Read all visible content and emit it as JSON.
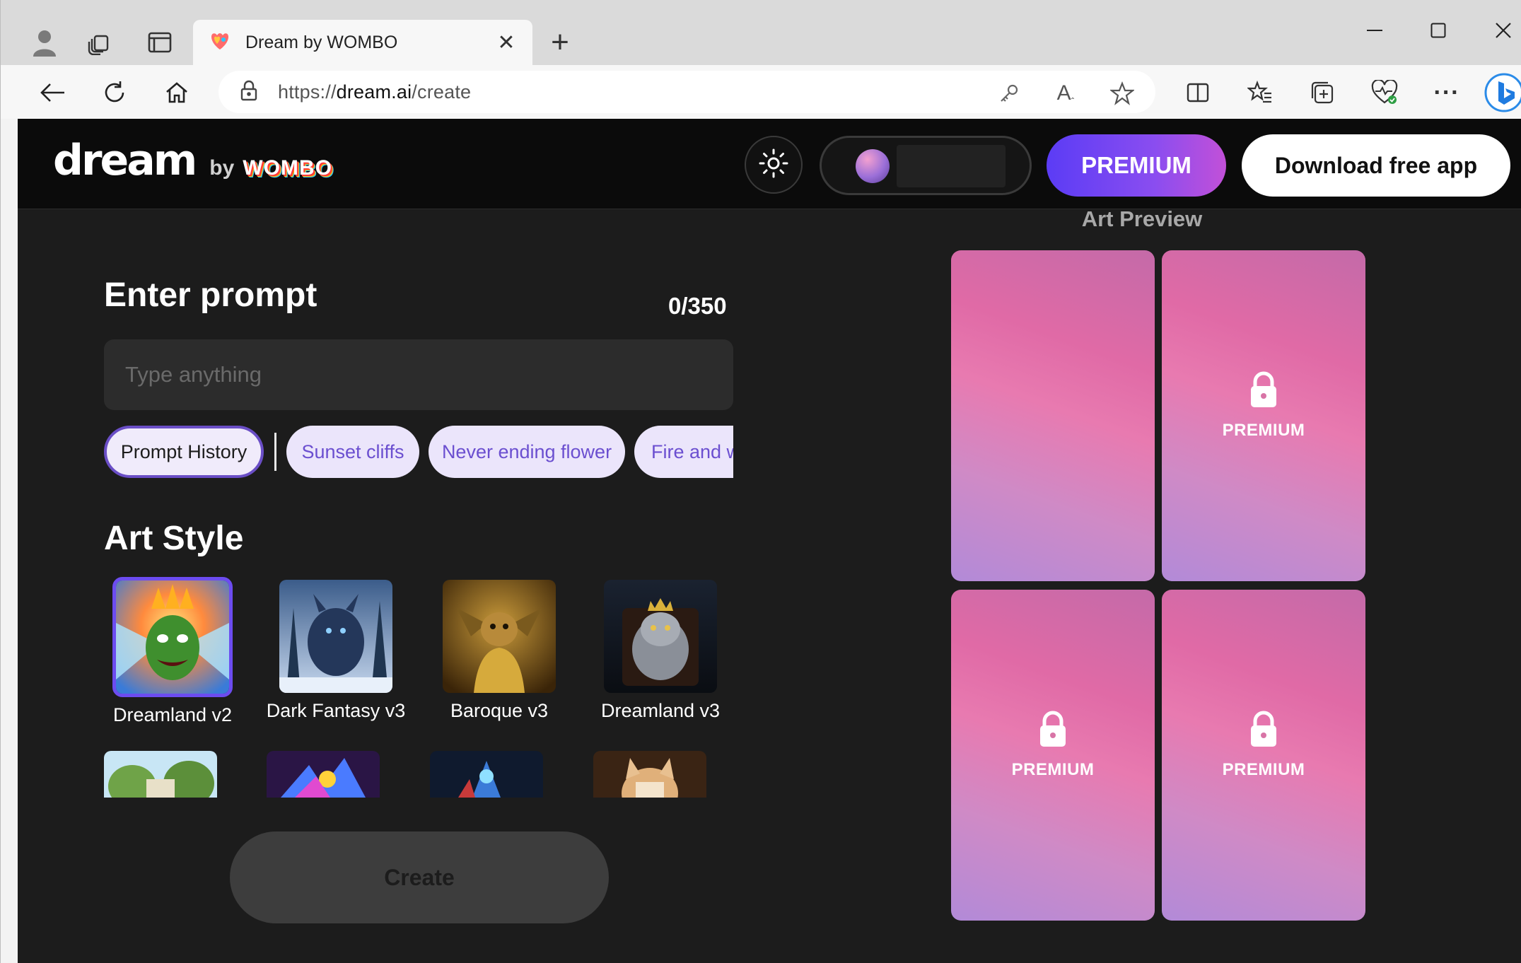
{
  "browser": {
    "tab_title": "Dream by WOMBO",
    "url_scheme": "https://",
    "url_host": "dream.ai",
    "url_path": "/create"
  },
  "header": {
    "logo_main": "dream",
    "logo_by": "by",
    "logo_brand": "WOMBO",
    "premium_label": "PREMIUM",
    "download_label": "Download free app"
  },
  "prompt": {
    "title": "Enter prompt",
    "counter": "0/350",
    "placeholder": "Type anything",
    "value": ""
  },
  "chips": {
    "history": "Prompt History",
    "suggestions": [
      "Sunset cliffs",
      "Never ending flower",
      "Fire and w"
    ]
  },
  "art_style": {
    "title": "Art Style",
    "styles": [
      "Dreamland v2",
      "Dark Fantasy v3",
      "Baroque v3",
      "Dreamland v3"
    ],
    "selected": "Dreamland v2"
  },
  "create_label": "Create",
  "preview": {
    "title": "Art Preview",
    "locked_label": "PREMIUM"
  }
}
